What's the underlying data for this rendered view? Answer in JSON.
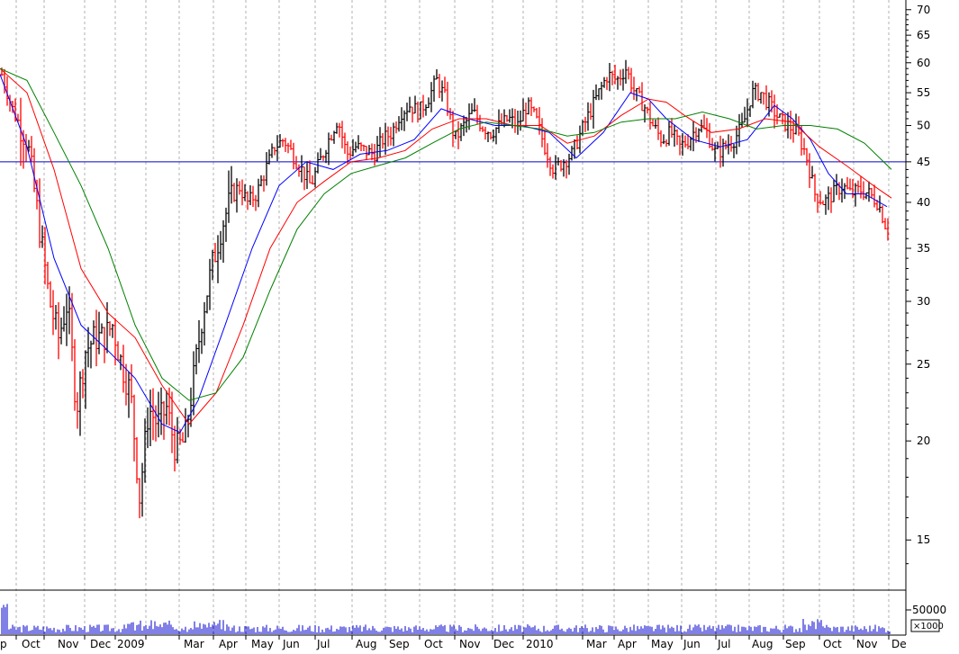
{
  "chart_data": {
    "type": "candlestick",
    "scale": "log",
    "ylim": [
      13,
      72
    ],
    "grid": "vertical dashed at month boundaries",
    "y_ticks": [
      15,
      20,
      25,
      30,
      35,
      40,
      45,
      50,
      55,
      60,
      65,
      70
    ],
    "x_month_labels": [
      "p",
      "Oct",
      "Nov",
      "Dec",
      "2009",
      "Mar",
      "Apr",
      "May",
      "Jun",
      "Jul",
      "Aug",
      "Sep",
      "Oct",
      "Nov",
      "Dec",
      "2010",
      "Mar",
      "Apr",
      "May",
      "Jun",
      "Jul",
      "Aug",
      "Sep",
      "Oct",
      "Nov",
      "De"
    ],
    "horizontal_line": {
      "value": 45,
      "color": "#0000cc"
    },
    "moving_averages": [
      {
        "color": "#0000ff",
        "points": [
          [
            0,
            58
          ],
          [
            30,
            47
          ],
          [
            60,
            34
          ],
          [
            90,
            28
          ],
          [
            120,
            26
          ],
          [
            150,
            24
          ],
          [
            180,
            21
          ],
          [
            200,
            20.5
          ],
          [
            220,
            22.5
          ],
          [
            250,
            28
          ],
          [
            280,
            35
          ],
          [
            310,
            42
          ],
          [
            340,
            45
          ],
          [
            370,
            44
          ],
          [
            400,
            46
          ],
          [
            430,
            46.5
          ],
          [
            460,
            48
          ],
          [
            490,
            52.5
          ],
          [
            520,
            51
          ],
          [
            550,
            50
          ],
          [
            580,
            50
          ],
          [
            610,
            49
          ],
          [
            640,
            45.5
          ],
          [
            670,
            49
          ],
          [
            700,
            55
          ],
          [
            720,
            54
          ],
          [
            740,
            51
          ],
          [
            770,
            48
          ],
          [
            800,
            47
          ],
          [
            830,
            48
          ],
          [
            860,
            53
          ],
          [
            880,
            51
          ],
          [
            900,
            48
          ],
          [
            920,
            43.5
          ],
          [
            940,
            41
          ],
          [
            960,
            41
          ],
          [
            985,
            39.5
          ]
        ]
      },
      {
        "color": "#ff0000",
        "points": [
          [
            0,
            59
          ],
          [
            30,
            55
          ],
          [
            60,
            44
          ],
          [
            90,
            33
          ],
          [
            120,
            29
          ],
          [
            150,
            27
          ],
          [
            180,
            23.5
          ],
          [
            210,
            21
          ],
          [
            240,
            23
          ],
          [
            270,
            28
          ],
          [
            300,
            35
          ],
          [
            330,
            40
          ],
          [
            360,
            42.5
          ],
          [
            390,
            45
          ],
          [
            420,
            45.5
          ],
          [
            450,
            46.5
          ],
          [
            480,
            49.5
          ],
          [
            510,
            51
          ],
          [
            540,
            51
          ],
          [
            570,
            50
          ],
          [
            600,
            50
          ],
          [
            630,
            47.5
          ],
          [
            660,
            48.5
          ],
          [
            690,
            51.5
          ],
          [
            720,
            54
          ],
          [
            740,
            53.5
          ],
          [
            760,
            51.5
          ],
          [
            790,
            49
          ],
          [
            820,
            49.5
          ],
          [
            850,
            51
          ],
          [
            880,
            50.5
          ],
          [
            910,
            47
          ],
          [
            940,
            44.5
          ],
          [
            970,
            42
          ],
          [
            990,
            40.5
          ]
        ]
      },
      {
        "color": "#008000",
        "points": [
          [
            0,
            59
          ],
          [
            30,
            57
          ],
          [
            60,
            49
          ],
          [
            90,
            42
          ],
          [
            120,
            35
          ],
          [
            150,
            28
          ],
          [
            180,
            24
          ],
          [
            210,
            22.5
          ],
          [
            240,
            23
          ],
          [
            270,
            25.5
          ],
          [
            300,
            31
          ],
          [
            330,
            37
          ],
          [
            360,
            41
          ],
          [
            390,
            43.5
          ],
          [
            420,
            44.5
          ],
          [
            450,
            45.5
          ],
          [
            480,
            47.5
          ],
          [
            510,
            49.5
          ],
          [
            540,
            50.5
          ],
          [
            570,
            50
          ],
          [
            600,
            49.5
          ],
          [
            630,
            48.5
          ],
          [
            660,
            49
          ],
          [
            690,
            50.5
          ],
          [
            720,
            51
          ],
          [
            750,
            51
          ],
          [
            780,
            52
          ],
          [
            810,
            51
          ],
          [
            840,
            49.5
          ],
          [
            870,
            50
          ],
          [
            900,
            50
          ],
          [
            930,
            49.5
          ],
          [
            960,
            47.5
          ],
          [
            990,
            44
          ]
        ]
      }
    ],
    "price_anchors": [
      [
        2,
        58
      ],
      [
        15,
        52
      ],
      [
        30,
        48
      ],
      [
        40,
        40
      ],
      [
        55,
        30
      ],
      [
        65,
        27
      ],
      [
        75,
        30
      ],
      [
        85,
        22
      ],
      [
        95,
        26
      ],
      [
        105,
        27
      ],
      [
        115,
        27
      ],
      [
        125,
        28
      ],
      [
        135,
        25
      ],
      [
        145,
        23
      ],
      [
        155,
        17
      ],
      [
        165,
        22
      ],
      [
        175,
        21
      ],
      [
        185,
        22
      ],
      [
        195,
        19.5
      ],
      [
        205,
        20
      ],
      [
        215,
        24
      ],
      [
        225,
        29
      ],
      [
        235,
        33
      ],
      [
        245,
        37
      ],
      [
        255,
        40
      ],
      [
        265,
        42
      ],
      [
        275,
        40
      ],
      [
        285,
        41
      ],
      [
        295,
        44
      ],
      [
        305,
        47
      ],
      [
        315,
        48
      ],
      [
        325,
        46
      ],
      [
        335,
        44
      ],
      [
        345,
        42
      ],
      [
        355,
        45
      ],
      [
        365,
        48
      ],
      [
        375,
        51
      ],
      [
        385,
        46
      ],
      [
        395,
        47
      ],
      [
        405,
        46.5
      ],
      [
        415,
        46
      ],
      [
        425,
        48
      ],
      [
        435,
        49
      ],
      [
        445,
        52
      ],
      [
        455,
        53
      ],
      [
        465,
        52
      ],
      [
        475,
        54
      ],
      [
        485,
        57
      ],
      [
        495,
        54
      ],
      [
        505,
        48
      ],
      [
        515,
        50
      ],
      [
        525,
        52
      ],
      [
        535,
        50
      ],
      [
        545,
        49
      ],
      [
        555,
        50
      ],
      [
        565,
        51
      ],
      [
        575,
        50
      ],
      [
        585,
        53
      ],
      [
        595,
        51
      ],
      [
        605,
        47
      ],
      [
        615,
        44
      ],
      [
        625,
        45
      ],
      [
        635,
        46
      ],
      [
        645,
        49
      ],
      [
        655,
        52
      ],
      [
        665,
        55
      ],
      [
        675,
        58
      ],
      [
        685,
        57
      ],
      [
        695,
        59
      ],
      [
        705,
        55
      ],
      [
        715,
        53
      ],
      [
        725,
        50
      ],
      [
        735,
        48
      ],
      [
        745,
        49
      ],
      [
        755,
        47
      ],
      [
        765,
        48
      ],
      [
        775,
        50
      ],
      [
        785,
        49
      ],
      [
        795,
        46
      ],
      [
        805,
        47
      ],
      [
        815,
        48
      ],
      [
        825,
        50
      ],
      [
        835,
        55
      ],
      [
        845,
        55
      ],
      [
        855,
        53
      ],
      [
        865,
        51
      ],
      [
        875,
        50
      ],
      [
        885,
        49
      ],
      [
        895,
        46
      ],
      [
        905,
        41
      ],
      [
        915,
        40
      ],
      [
        925,
        41
      ],
      [
        935,
        42
      ],
      [
        945,
        41
      ],
      [
        955,
        41.5
      ],
      [
        965,
        41
      ],
      [
        975,
        40
      ],
      [
        985,
        37
      ]
    ],
    "volume": {
      "axis_label": "50000",
      "unit_label": "×1000"
    }
  }
}
